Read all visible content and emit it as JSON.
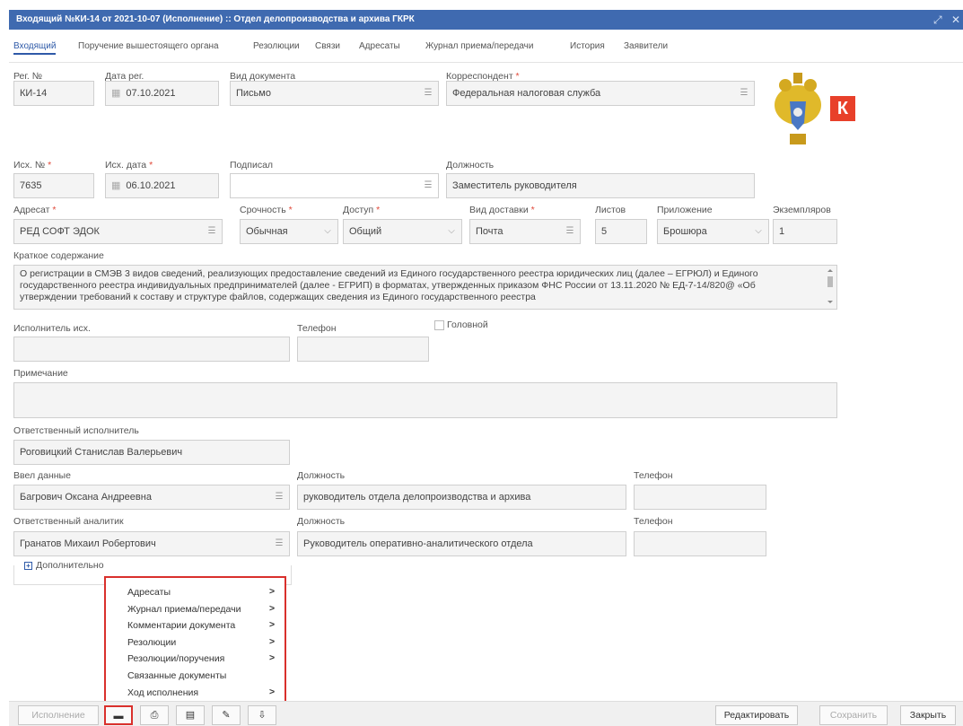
{
  "window": {
    "title": "Входящий №КИ-14 от 2021-10-07 (Исполнение) :: Отдел делопроизводства и архива ГКРК"
  },
  "tabs": [
    "Входящий",
    "Поручение вышестоящего органа",
    "Резолюции",
    "Связи",
    "Адресаты",
    "Журнал приема/передачи",
    "История",
    "Заявители"
  ],
  "logo": {
    "letter": "К",
    "color": "#e8402a"
  },
  "fields": {
    "reg_no": {
      "label": "Рег. №",
      "value": "КИ-14"
    },
    "reg_date": {
      "label": "Дата рег.",
      "value": "07.10.2021"
    },
    "doc_type": {
      "label": "Вид документа",
      "value": "Письмо"
    },
    "correspondent": {
      "label": "Корреспондент",
      "value": "Федеральная налоговая служба"
    },
    "out_no": {
      "label": "Исх. №",
      "value": "7635"
    },
    "out_date": {
      "label": "Исх. дата",
      "value": "06.10.2021"
    },
    "signed": {
      "label": "Подписал",
      "value": ""
    },
    "position": {
      "label": "Должность",
      "value": "Заместитель руководителя"
    },
    "addressee": {
      "label": "Адресат",
      "value": "РЕД СОФТ ЭДОК"
    },
    "urgency": {
      "label": "Срочность",
      "value": "Обычная"
    },
    "access": {
      "label": "Доступ",
      "value": "Общий"
    },
    "delivery": {
      "label": "Вид доставки",
      "value": "Почта"
    },
    "sheets": {
      "label": "Листов",
      "value": "5"
    },
    "attachment": {
      "label": "Приложение",
      "value": "Брошюра"
    },
    "copies": {
      "label": "Экземпляров",
      "value": "1"
    },
    "summary": {
      "label": "Краткое содержание",
      "value": "О регистрации в СМЭВ 3 видов сведений, реализующих предоставление сведений из Единого государственного реестра юридических лиц (далее – ЕГРЮЛ) и Единого государственного реестра индивидуальных предпринимателей (далее - ЕГРИП) в форматах, утвержденных приказом ФНС России от 13.11.2020 № ЕД-7-14/820@ «Об утверждении требований к составу и структуре файлов, содержащих сведения из Единого государственного реестра"
    },
    "executor_out": {
      "label": "Исполнитель исх.",
      "value": ""
    },
    "phone": {
      "label": "Телефон",
      "value": ""
    },
    "head": {
      "label": "Головной"
    },
    "note": {
      "label": "Примечание",
      "value": ""
    },
    "responsible": {
      "label": "Ответственный исполнитель",
      "value": "Роговицкий Станислав Валерьевич"
    },
    "entered": {
      "label": "Ввел данные",
      "value": "Багрович Оксана Андреевна"
    },
    "entered_position": {
      "label": "Должность",
      "value": "руководитель отдела делопроизводства и архива"
    },
    "entered_phone": {
      "label": "Телефон",
      "value": ""
    },
    "analyst": {
      "label": "Ответственный аналитик",
      "value": "Гранатов Михаил Робертович"
    },
    "analyst_position": {
      "label": "Должность",
      "value": "Руководитель оперативно-аналитического отдела"
    },
    "analyst_phone": {
      "label": "Телефон",
      "value": ""
    }
  },
  "additional": {
    "label": "Дополнительно"
  },
  "menu": [
    {
      "label": "Адресаты",
      "arrow": ">"
    },
    {
      "label": "Журнал приема/передачи",
      "arrow": ">"
    },
    {
      "label": "Комментарии документа",
      "arrow": ">"
    },
    {
      "label": "Резолюции",
      "arrow": ">"
    },
    {
      "label": "Резолюции/поручения",
      "arrow": ">"
    },
    {
      "label": "Связанные документы",
      "arrow": ""
    },
    {
      "label": "Ход исполнения",
      "arrow": ">"
    }
  ],
  "bottom": {
    "execution": "Исполнение",
    "edit": "Редактировать",
    "save": "Сохранить",
    "close": "Закрыть"
  }
}
